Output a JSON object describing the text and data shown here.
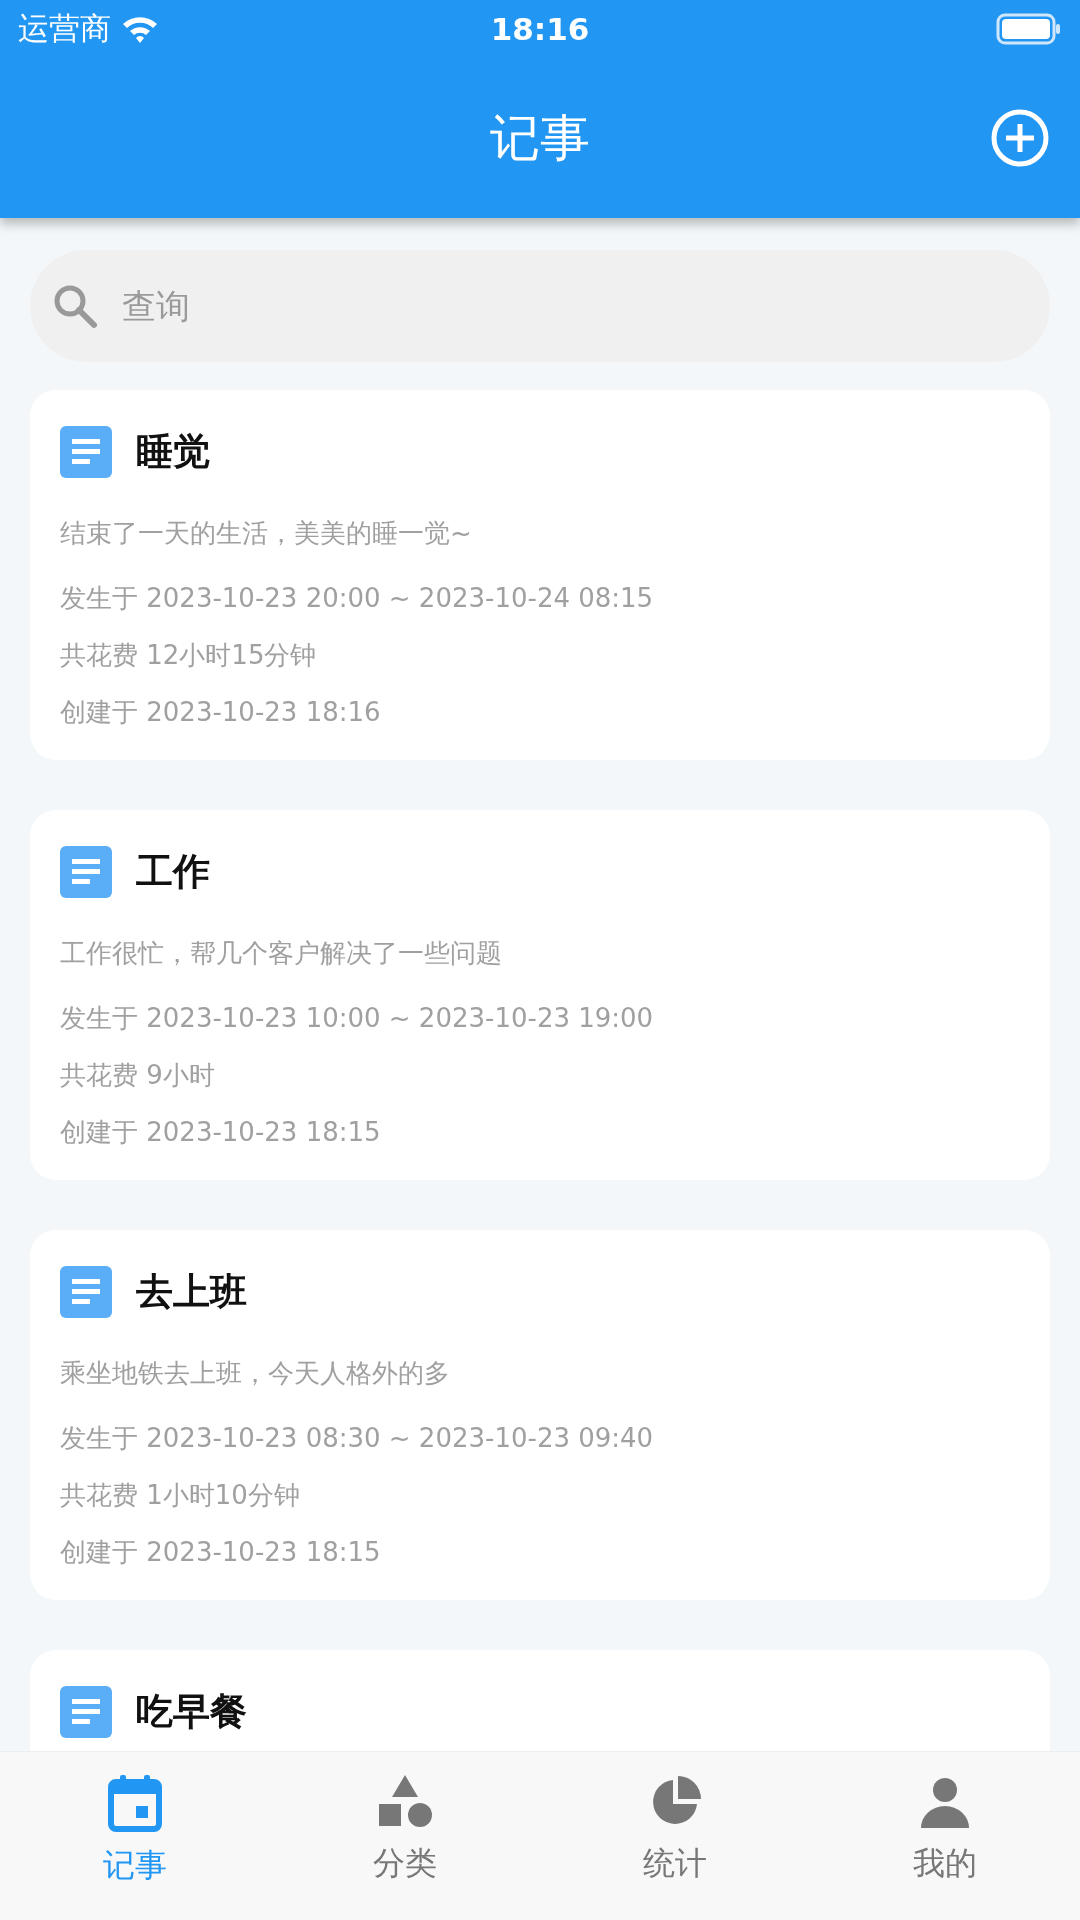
{
  "status_bar": {
    "carrier": "运营商",
    "time": "18:16"
  },
  "header": {
    "title": "记事"
  },
  "search": {
    "placeholder": "查询"
  },
  "notes": [
    {
      "title": "睡觉",
      "description": "结束了一天的生活，美美的睡一觉~",
      "occurred": "发生于 2023-10-23 20:00 ~ 2023-10-24 08:15",
      "duration": "共花费 12小时15分钟",
      "created": "创建于 2023-10-23 18:16"
    },
    {
      "title": "工作",
      "description": "工作很忙，帮几个客户解决了一些问题",
      "occurred": "发生于 2023-10-23 10:00 ~ 2023-10-23 19:00",
      "duration": "共花费 9小时",
      "created": "创建于 2023-10-23 18:15"
    },
    {
      "title": "去上班",
      "description": "乘坐地铁去上班，今天人格外的多",
      "occurred": "发生于 2023-10-23 08:30 ~ 2023-10-23 09:40",
      "duration": "共花费 1小时10分钟",
      "created": "创建于 2023-10-23 18:15"
    },
    {
      "title": "吃早餐"
    }
  ],
  "tab_bar": [
    {
      "label": "记事",
      "kind": "calendar",
      "selected": true
    },
    {
      "label": "分类",
      "kind": "shapes",
      "selected": false
    },
    {
      "label": "统计",
      "kind": "chart",
      "selected": false
    },
    {
      "label": "我的",
      "kind": "person",
      "selected": false
    }
  ]
}
